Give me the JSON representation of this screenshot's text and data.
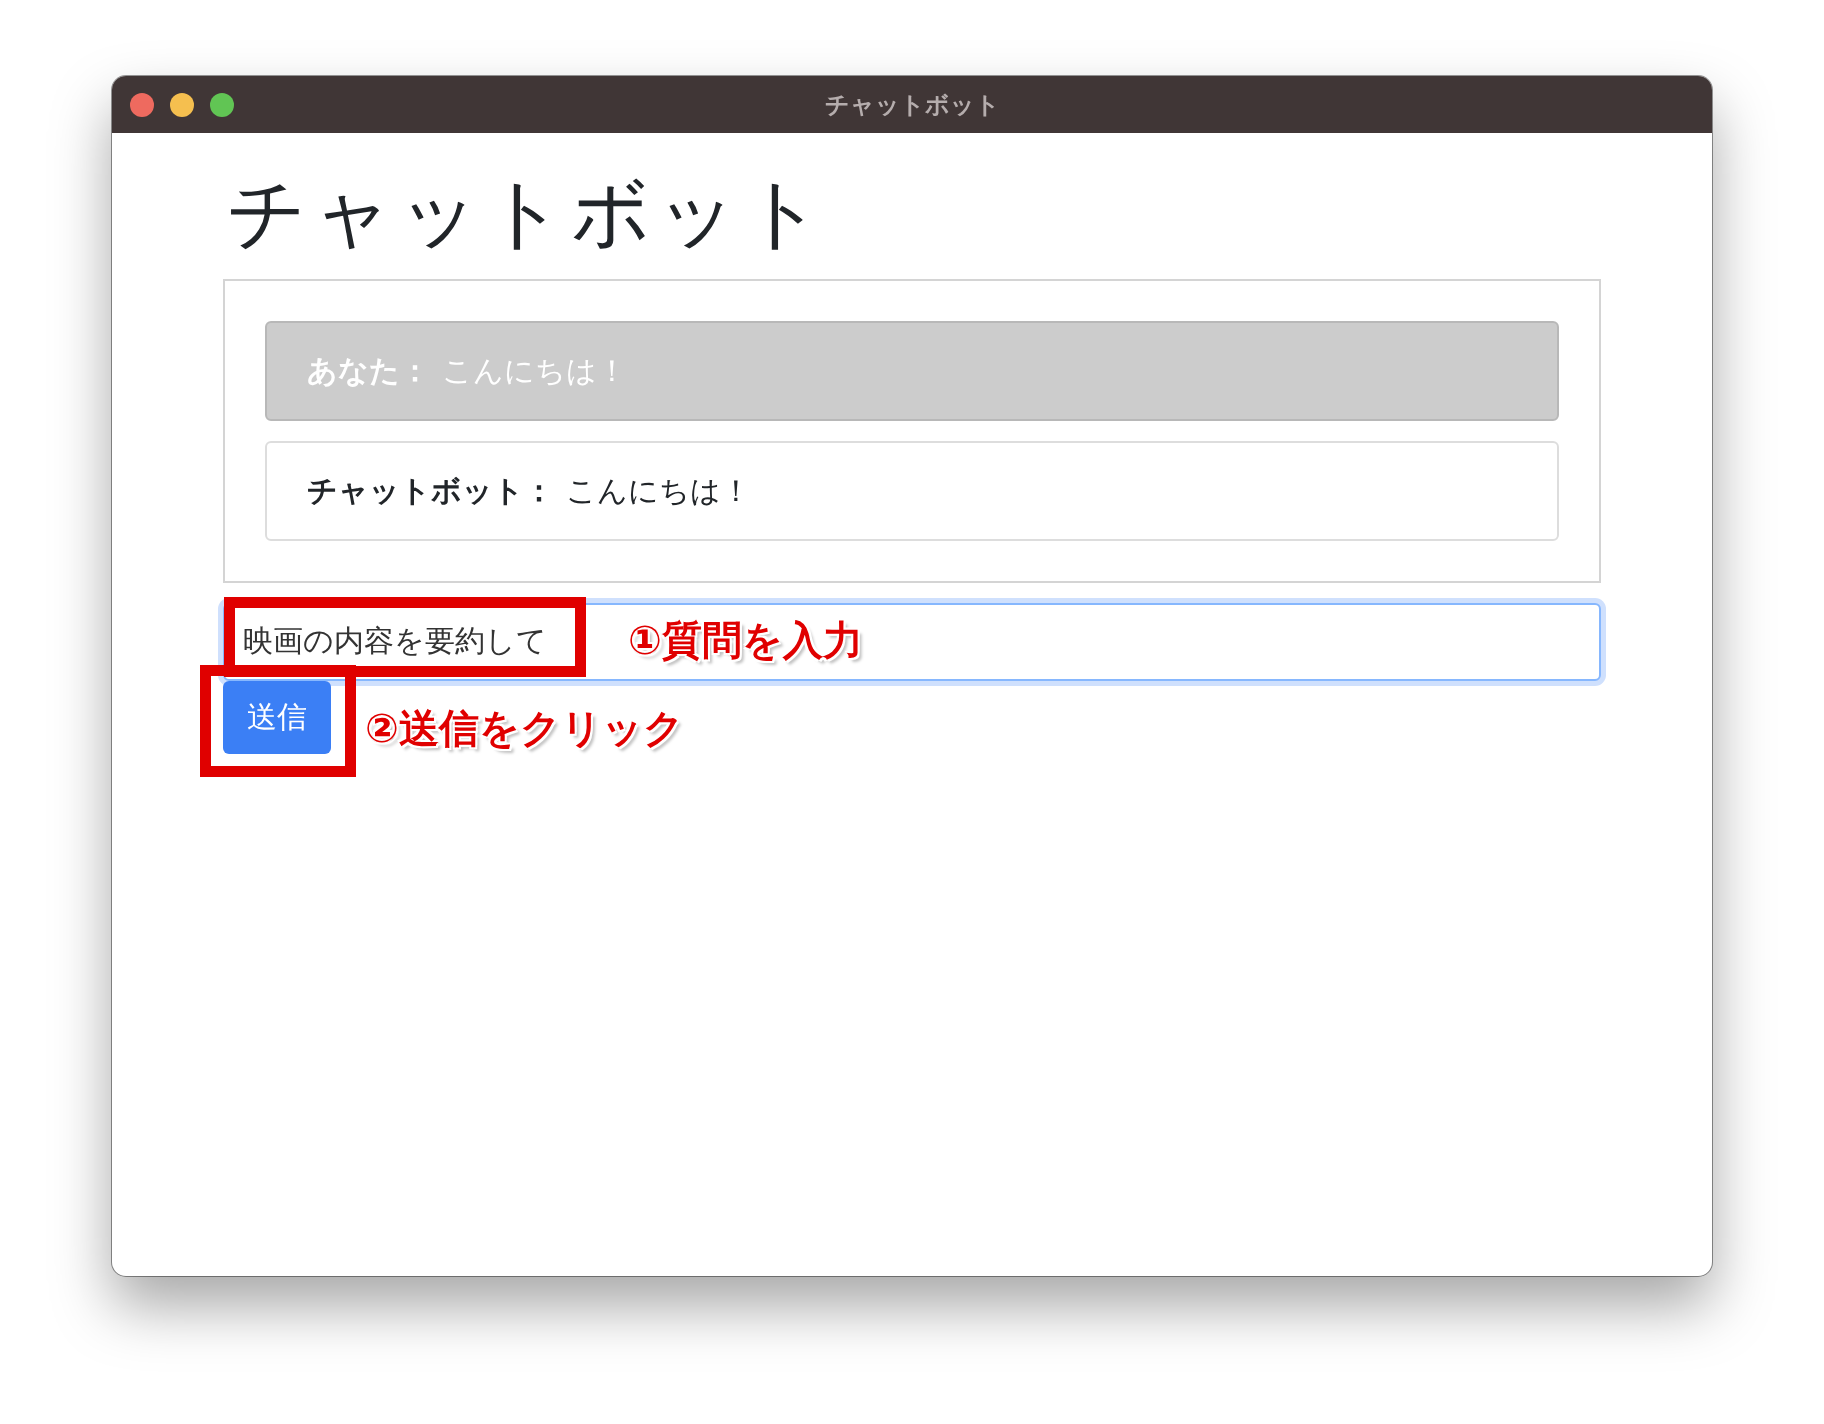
{
  "window": {
    "title": "チャットボット"
  },
  "heading": "チャットボット",
  "messages": [
    {
      "kind": "user",
      "sender": "あなた：",
      "text": "こんにちは！"
    },
    {
      "kind": "bot",
      "sender": "チャットボット：",
      "text": "こんにちは！"
    }
  ],
  "input": {
    "value": "映画の内容を要約して",
    "focused": true
  },
  "send_button": {
    "label": "送信"
  },
  "annotations": [
    {
      "kind": "input",
      "text": "①質問を入力"
    },
    {
      "kind": "button",
      "text": "②送信をクリック"
    }
  ]
}
